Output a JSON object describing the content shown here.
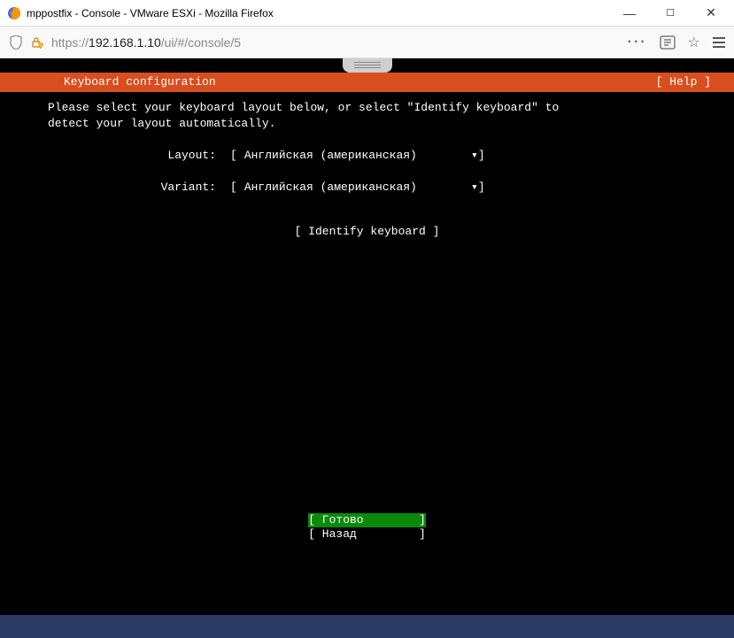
{
  "window": {
    "title": "mppostfix - Console - VMware ESXi - Mozilla Firefox"
  },
  "url": {
    "prefix": "https://",
    "host": "192.168.1.10",
    "path": "/ui/#/console/5"
  },
  "installer": {
    "header_title": "Keyboard configuration",
    "help_label": "[ Help ]",
    "instruction_line1": "Please select your keyboard layout below, or select \"Identify keyboard\" to",
    "instruction_line2": "detect your layout automatically.",
    "layout_label": "Layout:",
    "layout_value": "Английская (американская)",
    "variant_label": "Variant:",
    "variant_value": "Английская (американская)",
    "identify_label": "[ Identify keyboard ]",
    "done_label": "[ Готово        ]",
    "back_label": "[ Назад         ]",
    "dropdown_arrow": "▾",
    "bracket_l": "[",
    "bracket_r": "]"
  }
}
